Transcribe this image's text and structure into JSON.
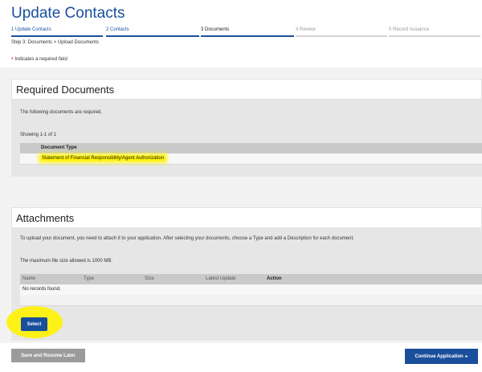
{
  "page": {
    "title": "Update Contacts"
  },
  "steps": [
    {
      "label": "1  Update Contacts",
      "state": "done"
    },
    {
      "label": "2  Contacts",
      "state": "done"
    },
    {
      "label": "3  Documents",
      "state": "current"
    },
    {
      "label": "4  Review",
      "state": "upcoming"
    },
    {
      "label": "5  Record Issuance",
      "state": "upcoming"
    }
  ],
  "breadcrumb": "Step 3: Documents > Upload Documents",
  "required_note": {
    "star": "*",
    "text": "Indicates a required field"
  },
  "required_documents": {
    "title": "Required Documents",
    "intro": "The following documents are required.",
    "showing": "Showing 1-1 of 1",
    "column_header": "Document Type",
    "rows": [
      {
        "document_type": "Statement of Financial Responsibility/Agent Authorization",
        "highlighted": true
      }
    ]
  },
  "attachments": {
    "title": "Attachments",
    "instructions": "To upload your document, you need to attach it to your application. After selecting your documents, choose a Type and add a Description for each document.",
    "max_size": "The maximum file size allowed is 1000 MB.",
    "columns": {
      "name": "Name",
      "type": "Type",
      "size": "Size",
      "latest_update": "Latest Update",
      "action": "Action"
    },
    "empty_message": "No records found.",
    "select_label": "Select",
    "select_highlighted": true
  },
  "footer": {
    "save_label": "Save and Resume Later",
    "continue_label": "Continue Application",
    "continue_icon": "chevron-right-icon"
  },
  "colors": {
    "accent": "#1a4f9c",
    "highlight": "#fff200",
    "secondary_button": "#9b9b9b",
    "required_star": "#d00000"
  }
}
